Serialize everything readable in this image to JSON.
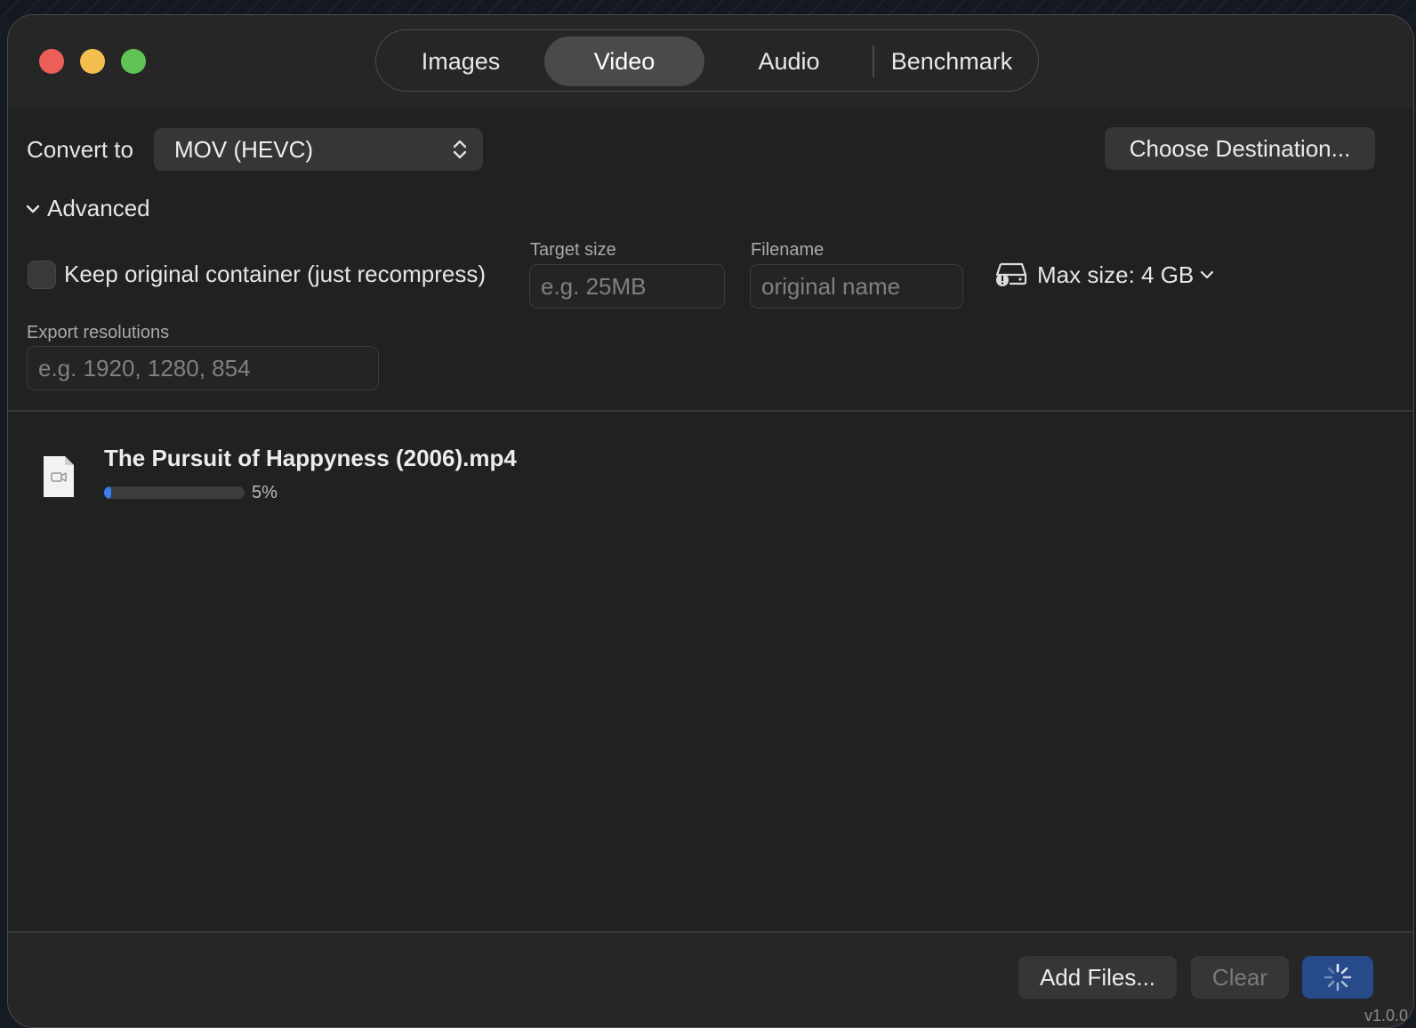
{
  "tabs": [
    {
      "label": "Images",
      "active": false
    },
    {
      "label": "Video",
      "active": true
    },
    {
      "label": "Audio",
      "active": false
    },
    {
      "label": "Benchmark",
      "active": false
    }
  ],
  "convert": {
    "label": "Convert to",
    "selected": "MOV (HEVC)"
  },
  "choose_destination_label": "Choose Destination...",
  "advanced": {
    "label": "Advanced",
    "keep_container_label": "Keep original container (just recompress)",
    "keep_container_checked": false,
    "target_size": {
      "label": "Target size",
      "value": "",
      "placeholder": "e.g. 25MB"
    },
    "filename": {
      "label": "Filename",
      "value": "",
      "placeholder": "original name"
    },
    "max_size_label": "Max size: 4 GB",
    "export_resolutions": {
      "label": "Export resolutions",
      "value": "",
      "placeholder": "e.g. 1920, 1280, 854"
    }
  },
  "files": [
    {
      "name": "The Pursuit of Happyness (2006).mp4",
      "progress": 0.05,
      "progress_label": "5%"
    }
  ],
  "footer": {
    "add_files_label": "Add Files...",
    "clear_label": "Clear",
    "version": "v1.0.0"
  },
  "colors": {
    "accent": "#3a7df5",
    "primary_button": "#264a8a",
    "window_bg": "#202121"
  }
}
